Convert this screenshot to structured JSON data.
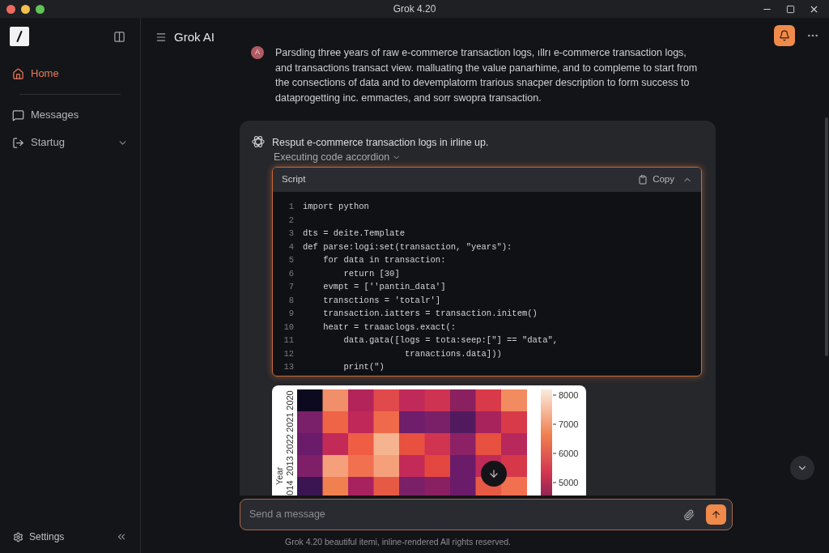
{
  "window": {
    "title": "Grok 4.20"
  },
  "sidebar": {
    "items": [
      {
        "label": "Home",
        "kind": "home",
        "selected": true
      },
      {
        "label": "Messages",
        "kind": "messages",
        "selected": false
      },
      {
        "label": "Startug",
        "kind": "startup",
        "selected": false,
        "expanded": false
      }
    ],
    "footer": {
      "label": "Settings"
    }
  },
  "header": {
    "title": "Grok AI"
  },
  "user_message": {
    "avatar": "A",
    "text": "Parsding three years of raw e-commerce transaction logs, ıllrı e-commerce transaction logs, and transactions transact view. malluating the value panarhime, and to compleme to start from the consections of data and to devemplatorm trarious snacper description to form success to dataprogetting inc. emmactes, and sorr swopra transaction."
  },
  "assistant_message": {
    "text": "Resput e-commerce transaction logs in irline up.",
    "accordion": {
      "label": "Executing code accordion",
      "expanded": true
    },
    "code": {
      "title": "Script",
      "copy_label": "Copy",
      "lines": [
        {
          "number": "1",
          "code": "import python"
        },
        {
          "number": "2"
        },
        {
          "number": "3",
          "code": "dts = deite.Template"
        },
        {
          "number": "4",
          "code": "def parse:logi:set(transaction, \"years\"):"
        },
        {
          "number": "5",
          "code": "    for data in transaction:"
        },
        {
          "number": "6",
          "code": "        return [30]"
        },
        {
          "number": "7",
          "code": "    evmpt = [''pantin_data']"
        },
        {
          "number": "8",
          "code": "    transctions = 'totalr']"
        },
        {
          "number": "9",
          "code": "    transaction.iatters = transaction.initem()"
        },
        {
          "number": "10",
          "code": "    heatr = traaaclogs.exact(:"
        },
        {
          "number": "11",
          "code": "        data.gata([logs = tota:seep:[\"] == \"data\","
        },
        {
          "number": "12",
          "code": "                    tranactions.data]))"
        },
        {
          "number": "13",
          "code": "        print(\")"
        }
      ]
    },
    "heatmap": {
      "axis_label": "Year",
      "row_labels": [
        "2020",
        "2021",
        "2022",
        "2013",
        "014"
      ],
      "colorbar_ticks": [
        "8000",
        "7000",
        "6000",
        "5000"
      ]
    }
  },
  "composer": {
    "placeholder": "Send a message"
  },
  "footer": {
    "text": "Grok 4.20  beautiful itemi, inline-rendered All rights reserved."
  }
}
